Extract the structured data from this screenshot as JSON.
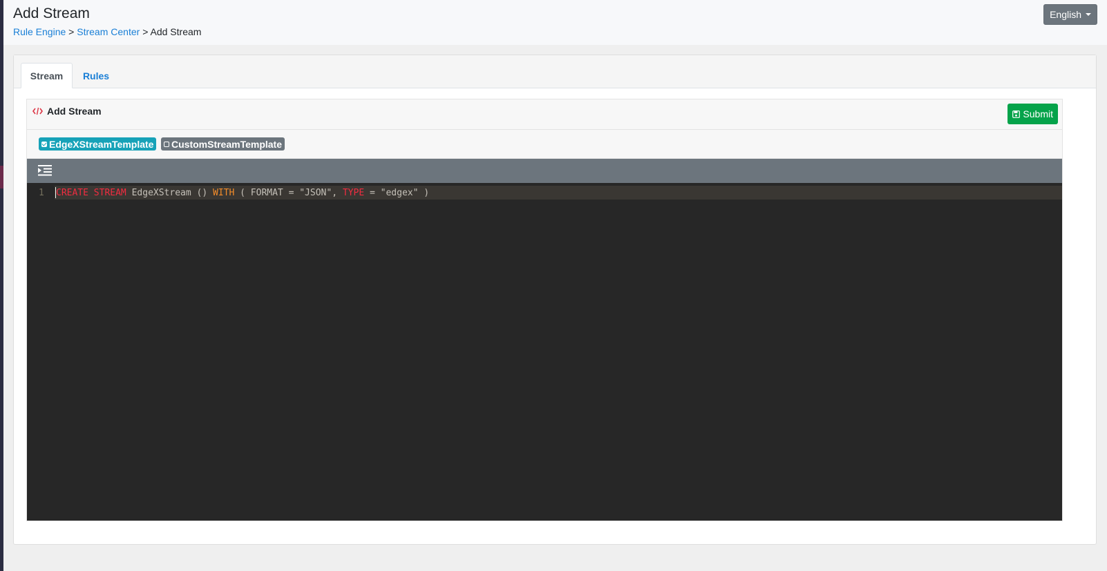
{
  "header": {
    "title": "Add Stream",
    "breadcrumb": {
      "item1": "Rule Engine",
      "sep1": ">",
      "item2": "Stream Center",
      "sep2": ">",
      "current": "Add Stream"
    },
    "language": "English"
  },
  "tabs": [
    {
      "label": "Stream",
      "active": true
    },
    {
      "label": "Rules",
      "active": false
    }
  ],
  "panel": {
    "title": "Add Stream",
    "title_icon": "code-icon",
    "submit_label": "Submit",
    "submit_icon": "save-icon",
    "templates": [
      {
        "label": "EdgeXStreamTemplate",
        "checked": true
      },
      {
        "label": "CustomStreamTemplate",
        "checked": false
      }
    ],
    "toolbar_icon": "indent-icon"
  },
  "editor": {
    "line_number": "1",
    "tokens": {
      "t1": "CREATE",
      "t2": " ",
      "t3": "STREAM",
      "t4": " EdgeXStream () ",
      "t5": "WITH",
      "t6": " ( FORMAT = \"JSON\", ",
      "t7": "TYPE",
      "t8": " = \"edgex\" )"
    }
  },
  "colors": {
    "link": "#1a7fd6",
    "submit": "#05a34a",
    "template_checked": "#17a2b8",
    "template_unchecked": "#6c757d",
    "editor_bg": "#272727",
    "keyword": "#f22c40",
    "keyword_with": "#f38c2a"
  }
}
